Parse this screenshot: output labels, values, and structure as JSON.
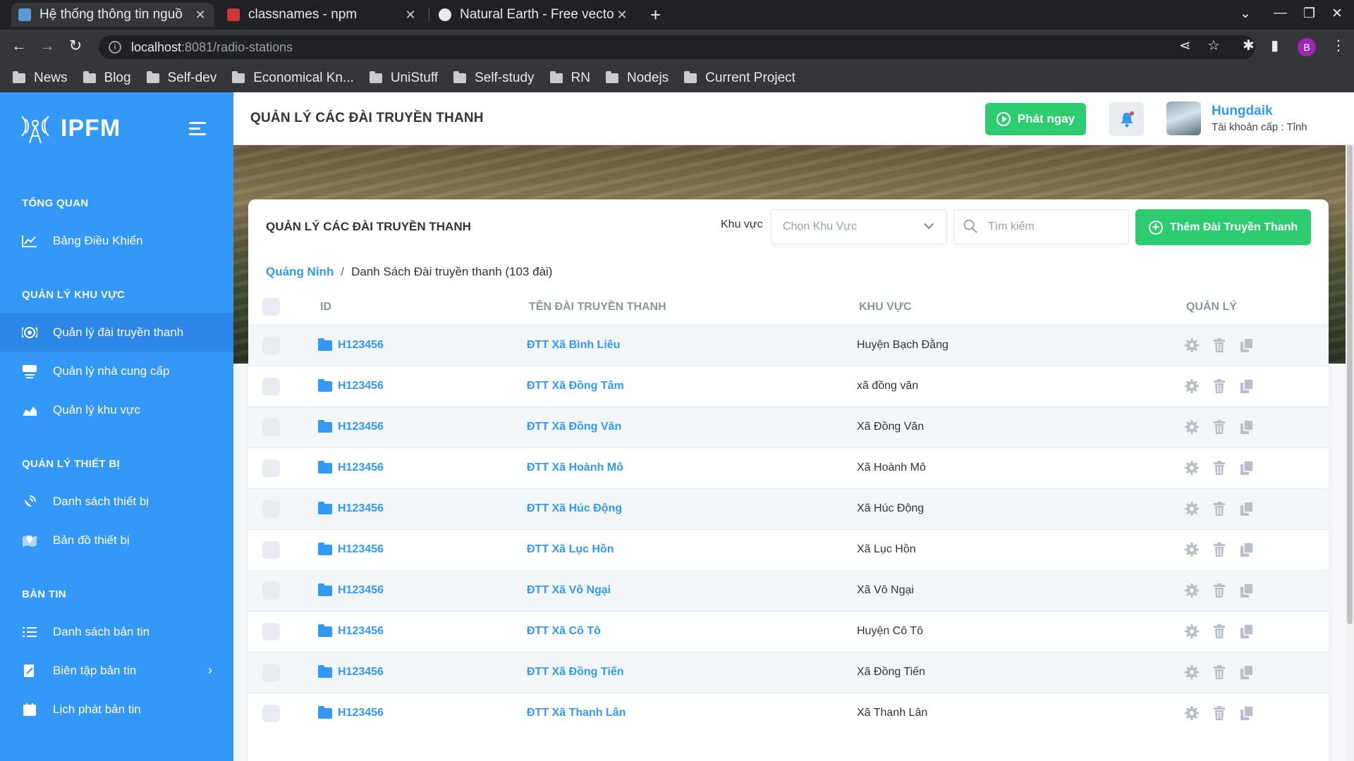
{
  "browser": {
    "tabs": [
      {
        "title": "Hệ thống thông tin nguồ",
        "active": true
      },
      {
        "title": "classnames - npm",
        "active": false
      },
      {
        "title": "Natural Earth - Free vecto",
        "active": false
      }
    ],
    "url_host": "localhost",
    "url_path": ":8081/radio-stations",
    "profile_initial": "B",
    "bookmarks": [
      "News",
      "Blog",
      "Self-dev",
      "Economical Kn...",
      "UniStuff",
      "Self-study",
      "RN",
      "Nodejs",
      "Current Project"
    ]
  },
  "sidebar": {
    "brand": "IPFM",
    "sections": [
      {
        "title": "TỔNG QUAN",
        "items": [
          {
            "label": "Bảng Điều Khiển",
            "icon": "chart-line-icon"
          }
        ]
      },
      {
        "title": "QUẢN LÝ KHU VỰC",
        "items": [
          {
            "label": "Quản lý đài truyền thanh",
            "icon": "radio-icon"
          },
          {
            "label": "Quản lý nhà cung cấp",
            "icon": "provider-icon"
          },
          {
            "label": "Quản lý khu vực",
            "icon": "area-chart-icon"
          }
        ]
      },
      {
        "title": "QUẢN LÝ THIẾT BỊ",
        "items": [
          {
            "label": "Danh sách thiết bị",
            "icon": "satellite-icon"
          },
          {
            "label": "Bản đồ thiết bị",
            "icon": "map-pin-icon"
          }
        ]
      },
      {
        "title": "BẢN TIN",
        "items": [
          {
            "label": "Danh sách bản tin",
            "icon": "list-icon"
          },
          {
            "label": "Biên tập bản tin",
            "icon": "edit-icon"
          },
          {
            "label": "Lịch phát bản tin",
            "icon": "calendar-icon"
          }
        ]
      }
    ]
  },
  "header": {
    "title": "QUẢN LÝ CÁC ĐÀI TRUYỀN THANH",
    "play_label": "Phát ngay",
    "user_name": "Hungdaik",
    "user_role": "Tài khoản cấp : Tỉnh"
  },
  "card": {
    "title": "QUẢN LÝ CÁC ĐÀI TRUYỀN THANH",
    "filter_label": "Khu vực",
    "select_placeholder": "Chọn Khu Vực",
    "search_placeholder": "Tìm kiếm",
    "add_label": "Thêm Đài Truyền Thanh",
    "breadcrumb_link": "Quảng Ninh",
    "breadcrumb_current": "Danh Sách Đài truyền thanh (103 đài)"
  },
  "table": {
    "columns": [
      "ID",
      "TÊN ĐÀI TRUYỀN THANH",
      "KHU VỰC",
      "QUẢN LÝ"
    ],
    "rows": [
      {
        "id": "H123456",
        "name": "ĐTT Xã Bình Liêu",
        "area": "Huyện Bạch Đằng"
      },
      {
        "id": "H123456",
        "name": "ĐTT Xã Đồng Tâm",
        "area": "xã đồng văn"
      },
      {
        "id": "H123456",
        "name": "ĐTT Xã Đồng Văn",
        "area": "Xã Đồng Văn"
      },
      {
        "id": "H123456",
        "name": "ĐTT Xã Hoành Mô",
        "area": "Xã Hoành Mô"
      },
      {
        "id": "H123456",
        "name": "ĐTT Xã Húc Động",
        "area": "Xã Húc Động"
      },
      {
        "id": "H123456",
        "name": "ĐTT Xã Lục Hồn",
        "area": "Xã Lục Hồn"
      },
      {
        "id": "H123456",
        "name": "ĐTT Xã Vô Ngại",
        "area": "Xã Vô Ngại"
      },
      {
        "id": "H123456",
        "name": "ĐTT Xã Cô Tô",
        "area": "Huyện Cô Tô"
      },
      {
        "id": "H123456",
        "name": "ĐTT Xã Đồng Tiến",
        "area": "Xã Đồng Tiến"
      },
      {
        "id": "H123456",
        "name": "ĐTT Xã Thanh Lân",
        "area": "Xã Thanh Lân"
      }
    ]
  },
  "colors": {
    "primary": "#3498f8",
    "success": "#2ecc71",
    "notification_dot": "#e74c3c"
  }
}
